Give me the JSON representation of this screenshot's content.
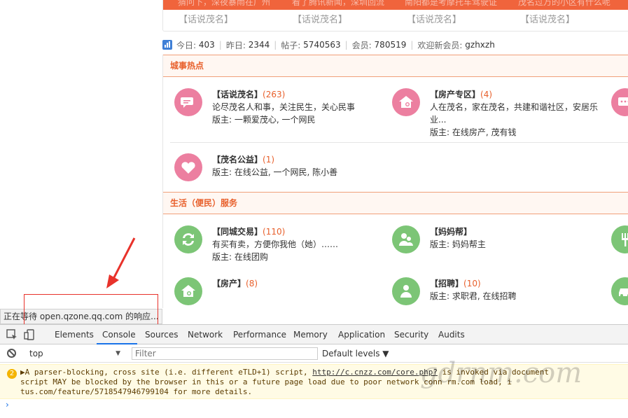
{
  "banner": {
    "items": [
      "猜问下，深夜暴雨在广州",
      "看了腾讯新闻，深圳回流",
      "南阳都是考摩托车驾驶证",
      "茂名过万的小区有什么呢"
    ]
  },
  "topic_tags": [
    "【话说茂名】",
    "【话说茂名】",
    "【话说茂名】",
    "【话说茂名】"
  ],
  "stats": {
    "today_label": "今日:",
    "today": "403",
    "yesterday_label": "昨日:",
    "yesterday": "2344",
    "posts_label": "帖子:",
    "posts": "5740563",
    "members_label": "会员:",
    "members": "780519",
    "welcome_label": "欢迎新会员:",
    "newest": "gzhxzh"
  },
  "sections": [
    {
      "title": "城事热点",
      "forums": [
        {
          "name": "【话说茂名】",
          "count": "(263)",
          "desc": "论尽茂名人和事，关注民生，关心民事",
          "mod": "版主: 一颗爱茂心, 一个网民",
          "icon": "chat-bubble-icon",
          "color": "#ec7fa0"
        },
        {
          "name": "【房产专区】",
          "count": "(4)",
          "desc": "人在茂名，家在茂名，共建和谐社区，安居乐业...",
          "mod": "版主: 在线房产, 茂有钱",
          "icon": "house-icon",
          "color": "#ec7fa0"
        },
        {
          "name": "【茂名公益】",
          "count": "(1)",
          "desc": "",
          "mod": "版主: 在线公益, 一个网民, 陈小善",
          "icon": "heart-icon",
          "color": "#ec7fa0"
        }
      ]
    },
    {
      "title": "生活（便民）服务",
      "forums": [
        {
          "name": "【同城交易】",
          "count": "(110)",
          "desc": "有买有卖，方便你我他（她）……",
          "mod": "版主: 在线团购",
          "icon": "exchange-icon",
          "color": "#7cc576"
        },
        {
          "name": "【妈妈帮】",
          "count": "",
          "desc": "",
          "mod": "版主: 妈妈帮主",
          "icon": "mother-child-icon",
          "color": "#7cc576"
        },
        {
          "name": "【房产】",
          "count": "(8)",
          "desc": "",
          "mod": "",
          "icon": "house-search-icon",
          "color": "#7cc576"
        },
        {
          "name": "【招聘】",
          "count": "(10)",
          "desc": "",
          "mod": "版主: 求职君, 在线招聘",
          "icon": "person-icon",
          "color": "#7cc576"
        }
      ]
    }
  ],
  "status_bar": "正在等待 open.qzone.qq.com 的响应...",
  "devtools": {
    "tabs": [
      "Elements",
      "Console",
      "Sources",
      "Network",
      "Performance",
      "Memory",
      "Application",
      "Security",
      "Audits"
    ],
    "active_tab": "Console",
    "context": "top",
    "filter_placeholder": "Filter",
    "levels": "Default levels ▼",
    "warning_count": "2",
    "warning_lines": [
      "▶A parser-blocking, cross site (i.e. different eTLD+1) script, ",
      "script MAY be blocked by the browser in this or a future page load due to poor network conn",
      "tus.com/feature/5718547946799104 for more details."
    ],
    "warning_link": "http://c.cnzz.com/core.php?",
    "warning_tail1": "                         is invoked via document",
    "warning_tail2": "                   rm.com                    load, i",
    "prompt": "›"
  },
  "watermark": "gdrnm.com"
}
